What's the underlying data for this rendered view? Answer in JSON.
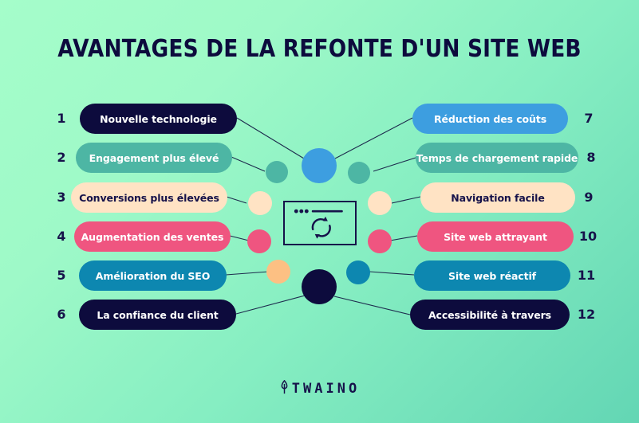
{
  "title": "AVANTAGES DE LA REFONTE D'UN SITE WEB",
  "brand": {
    "name": "TWAINO",
    "logo_icon": "leaf-icon"
  },
  "theme": {
    "background_from": "#a5fdca",
    "background_to": "#63d6b4",
    "navy": "#0d0b3d",
    "text_light": "#ffffff",
    "text_dark": "#16124a"
  },
  "center": {
    "browser_icon": "browser-window-icon",
    "refresh_icon": "refresh-arrows-icon",
    "dots_icon": "three-dots-icon",
    "hub_top_color": "#3d9ee0",
    "hub_bottom_color": "#0d0b3d"
  },
  "left_items": [
    {
      "number": "1",
      "label": "Nouvelle technologie",
      "bg": "#0d0b3d",
      "fg": "#ffffff"
    },
    {
      "number": "2",
      "label": "Engagement plus élevé",
      "bg": "#4db6a4",
      "fg": "#ffffff"
    },
    {
      "number": "3",
      "label": "Conversions plus élevées",
      "bg": "#ffe3c4",
      "fg": "#16124a"
    },
    {
      "number": "4",
      "label": "Augmentation des ventes",
      "bg": "#ef5580",
      "fg": "#ffffff"
    },
    {
      "number": "5",
      "label": "Amélioration du SEO",
      "bg": "#0d87b0",
      "fg": "#ffffff"
    },
    {
      "number": "6",
      "label": "La confiance du client",
      "bg": "#0d0b3d",
      "fg": "#ffffff"
    }
  ],
  "right_items": [
    {
      "number": "7",
      "label": "Réduction des coûts",
      "bg": "#3d9ee0",
      "fg": "#ffffff"
    },
    {
      "number": "8",
      "label": "Temps de chargement rapide",
      "bg": "#4db6a4",
      "fg": "#ffffff"
    },
    {
      "number": "9",
      "label": "Navigation facile",
      "bg": "#ffe3c4",
      "fg": "#16124a"
    },
    {
      "number": "10",
      "label": "Site web attrayant",
      "bg": "#ef5580",
      "fg": "#ffffff"
    },
    {
      "number": "11",
      "label": "Site web réactif",
      "bg": "#0d87b0",
      "fg": "#ffffff"
    },
    {
      "number": "12",
      "label": "Accessibilité à travers",
      "bg": "#0d0b3d",
      "fg": "#ffffff"
    }
  ],
  "left_dots": [
    {
      "color": "#4db6a4"
    },
    {
      "color": "#ffe3c4"
    },
    {
      "color": "#ef5580"
    },
    {
      "color": "#fcc083"
    }
  ],
  "right_dots": [
    {
      "color": "#4db6a4"
    },
    {
      "color": "#ffe3c4"
    },
    {
      "color": "#ef5580"
    },
    {
      "color": "#0d87b0"
    }
  ]
}
